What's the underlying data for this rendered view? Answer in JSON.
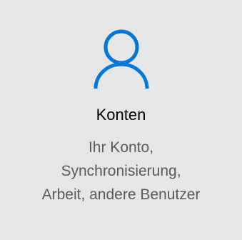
{
  "tile": {
    "icon": "user-icon",
    "title": "Konten",
    "description_lines": [
      "Ihr Konto,",
      "Synchronisierung,",
      "Arbeit, andere Benutzer"
    ]
  },
  "colors": {
    "background": "#e6e6e6",
    "accent": "#0078d7",
    "title": "#000000",
    "description": "#5a5a5a"
  }
}
